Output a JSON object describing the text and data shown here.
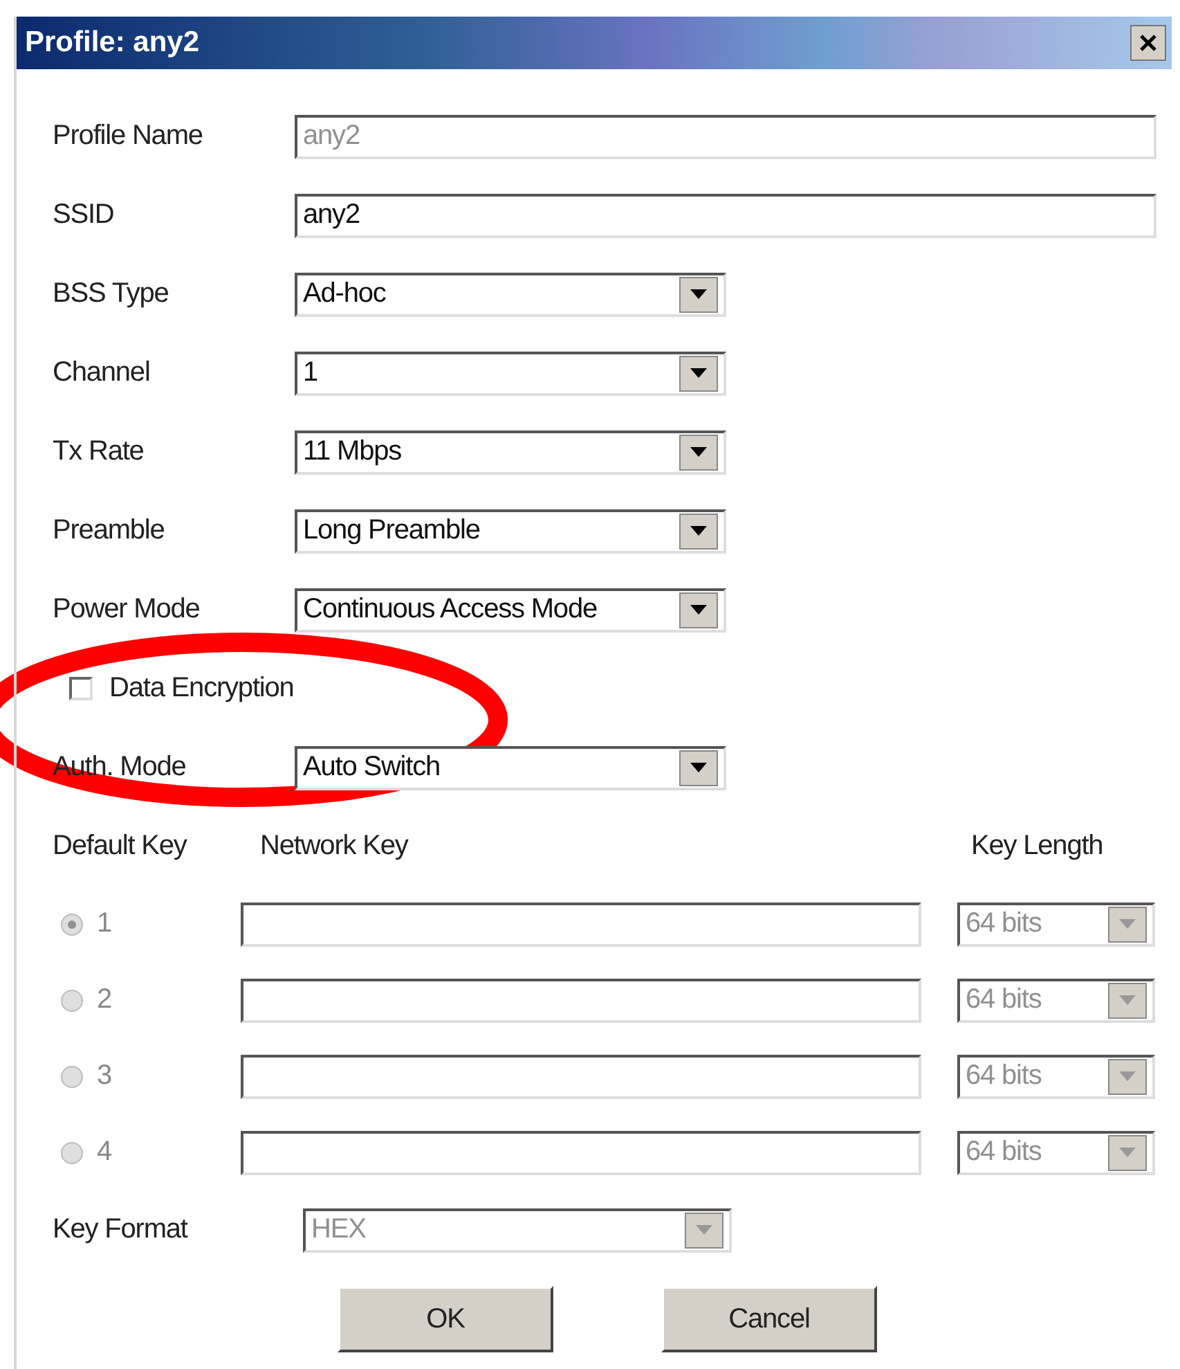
{
  "window": {
    "title": "Profile: any2"
  },
  "fields": [
    {
      "kind": "text",
      "label": "Profile Name",
      "value": "any2",
      "disabled": true
    },
    {
      "kind": "text",
      "label": "SSID",
      "value": "any2",
      "disabled": false
    },
    {
      "kind": "select",
      "label": "BSS Type",
      "value": "Ad-hoc",
      "disabled": false
    },
    {
      "kind": "select",
      "label": "Channel",
      "value": "1",
      "disabled": false
    },
    {
      "kind": "select",
      "label": "Tx Rate",
      "value": "11 Mbps",
      "disabled": false
    },
    {
      "kind": "select",
      "label": "Preamble",
      "value": "Long Preamble",
      "disabled": false
    },
    {
      "kind": "select",
      "label": "Power Mode",
      "value": "Continuous Access Mode",
      "disabled": false
    }
  ],
  "data_encryption": {
    "label": "Data Encryption",
    "checked": false
  },
  "auth_mode": {
    "label": "Auth. Mode",
    "value": "Auto Switch"
  },
  "keys_header": {
    "default_key": "Default Key",
    "network_key": "Network Key",
    "key_length": "Key Length"
  },
  "keys": [
    {
      "number": "1",
      "selected": true,
      "length": "64 bits"
    },
    {
      "number": "2",
      "selected": false,
      "length": "64 bits"
    },
    {
      "number": "3",
      "selected": false,
      "length": "64 bits"
    },
    {
      "number": "4",
      "selected": false,
      "length": "64 bits"
    }
  ],
  "keys_disabled": true,
  "key_format": {
    "label": "Key Format",
    "value": "HEX",
    "disabled": true
  },
  "buttons": [
    "OK",
    "Cancel"
  ]
}
